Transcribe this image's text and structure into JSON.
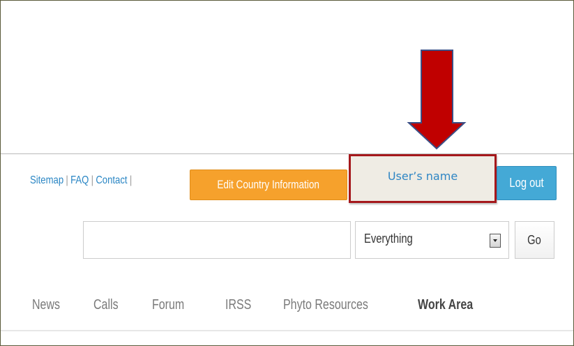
{
  "top_links": {
    "sitemap": "Sitemap",
    "faq": "FAQ",
    "contact": "Contact",
    "separator": "|"
  },
  "buttons": {
    "edit_country": "Edit Country Information",
    "logout": "Log out",
    "go": "Go"
  },
  "user": {
    "name_label": "User’s name"
  },
  "search": {
    "value": "",
    "placeholder": "",
    "scope_selected": "Everything"
  },
  "nav": {
    "items": [
      {
        "label": "News"
      },
      {
        "label": "Calls"
      },
      {
        "label": "Forum"
      },
      {
        "label": "IRSS"
      },
      {
        "label": "Phyto Resources"
      },
      {
        "label": "Work Area"
      }
    ]
  },
  "colors": {
    "link_blue": "#2a86c4",
    "edit_orange": "#f6a12c",
    "logout_blue": "#44a9d6",
    "highlight_red": "#a5181c",
    "arrow_red": "#c00000",
    "arrow_outline": "#3b4f86"
  },
  "annotation": {
    "icon": "down-arrow-icon"
  }
}
